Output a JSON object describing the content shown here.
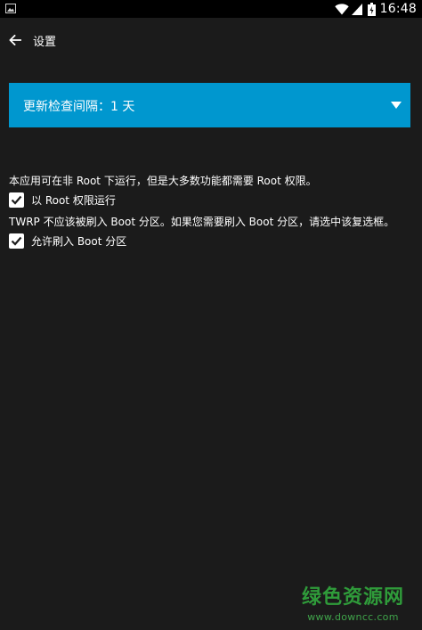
{
  "status_bar": {
    "time": "16:48",
    "left_icon": "image-notification-icon",
    "icons": [
      "wifi-icon",
      "signal-icon",
      "battery-icon"
    ]
  },
  "app_bar": {
    "back_icon": "arrow-left-icon",
    "title": "设置"
  },
  "spinner": {
    "selected_label": "更新检查间隔：1 天",
    "arrow_icon": "triangle-down-icon",
    "color": "#0097cf"
  },
  "settings": {
    "root_note": "本应用可在非 Root 下运行，但是大多数功能都需要 Root 权限。",
    "root_checkbox": {
      "label": "以 Root 权限运行",
      "checked": true
    },
    "boot_note": "TWRP 不应该被刷入 Boot 分区。如果您需要刷入 Boot 分区，请选中该复选框。",
    "boot_checkbox": {
      "label": "允许刷入 Boot 分区",
      "checked": true
    }
  },
  "watermark": {
    "main": "绿色资源网",
    "url": "www.downcc.com"
  }
}
